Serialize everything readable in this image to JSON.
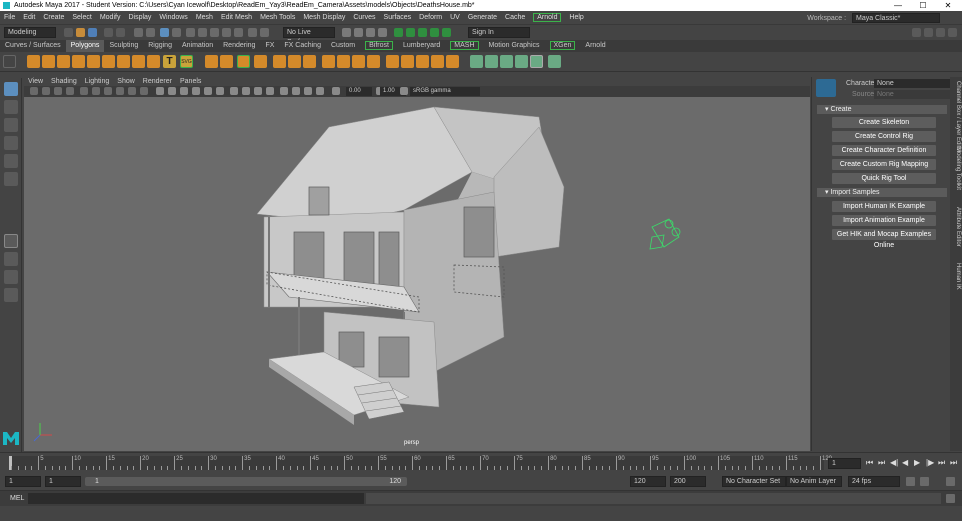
{
  "window": {
    "title": "Autodesk Maya 2017 - Student Version: C:\\Users\\Cyan Icewolf\\Desktop\\ReadEm_Yay3\\ReadEm_Camera\\Assets\\models\\Objects\\DeathsHouse.mb*",
    "minimize": "—",
    "maximize": "☐",
    "close": "✕"
  },
  "menu": {
    "items": [
      "File",
      "Edit",
      "Create",
      "Select",
      "Modify",
      "Display",
      "Windows",
      "Mesh",
      "Edit Mesh",
      "Mesh Tools",
      "Mesh Display",
      "Curves",
      "Surfaces",
      "Deform",
      "UV",
      "Generate",
      "Cache"
    ],
    "arnold": "Arnold",
    "help": "Help"
  },
  "workspace": {
    "label": "Workspace :",
    "value": "Maya Classic*"
  },
  "status": {
    "mode": "Modeling",
    "live_surface": "No Live Surface",
    "sign_in": "Sign In"
  },
  "shelf_tabs": [
    {
      "label": "Curves / Surfaces"
    },
    {
      "label": "Polygons",
      "active": true
    },
    {
      "label": "Sculpting"
    },
    {
      "label": "Rigging"
    },
    {
      "label": "Animation"
    },
    {
      "label": "Rendering"
    },
    {
      "label": "FX"
    },
    {
      "label": "FX Caching"
    },
    {
      "label": "Custom"
    },
    {
      "label": "Bifrost",
      "green": true
    },
    {
      "label": "Lumberyard"
    },
    {
      "label": "MASH",
      "green": true
    },
    {
      "label": "Motion Graphics"
    },
    {
      "label": "XGen",
      "green": true
    },
    {
      "label": "Arnold"
    }
  ],
  "shelf_text": {
    "t_icon": "T",
    "svg_icon": "SVG"
  },
  "viewport": {
    "menus": [
      "View",
      "Shading",
      "Lighting",
      "Show",
      "Renderer",
      "Panels"
    ],
    "exposure": "0.00",
    "gamma": "1.00",
    "color_space": "sRGB gamma",
    "camera_label": "persp"
  },
  "hik": {
    "character_label": "Character:",
    "character_value": "None",
    "source_label": "Source:",
    "source_value": "None",
    "create_header": "Create",
    "create_buttons": [
      "Create Skeleton",
      "Create Control Rig",
      "Create Character Definition",
      "Create Custom Rig Mapping",
      "Quick Rig Tool"
    ],
    "samples_header": "Import Samples",
    "sample_buttons": [
      "Import Human IK Example",
      "Import Animation Example",
      "Get HIK and Mocap Examples Online"
    ]
  },
  "right_tabs": [
    "Channel Box / Layer Editor",
    "Modeling Toolkit",
    "Attribute Editor",
    "Human IK"
  ],
  "timeline": {
    "ticks": [
      "5",
      "10",
      "15",
      "20",
      "25",
      "30",
      "35",
      "40",
      "45",
      "50",
      "55",
      "60",
      "65",
      "70",
      "75",
      "80",
      "85",
      "90",
      "95",
      "100",
      "105",
      "110",
      "115",
      "120"
    ],
    "current_frame": "1"
  },
  "range": {
    "start": "1",
    "anim_start": "1",
    "inner_start": "1",
    "inner_end": "120",
    "end": "120",
    "anim_end": "200",
    "character_set": "No Character Set",
    "anim_layer": "No Anim Layer",
    "fps": "24 fps"
  },
  "cmd": {
    "label": "MEL"
  }
}
